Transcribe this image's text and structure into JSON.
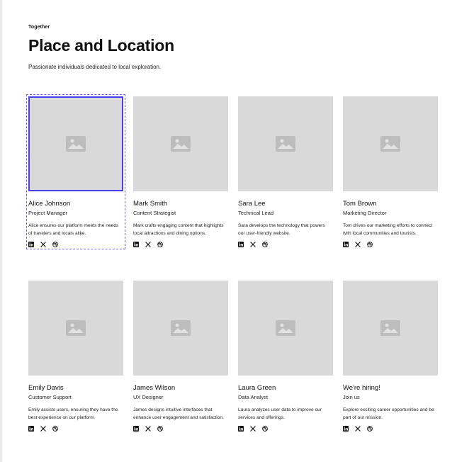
{
  "header": {
    "eyebrow": "Together",
    "title": "Place and Location",
    "subtitle": "Passionate individuals dedicated to local exploration."
  },
  "team": [
    {
      "name": "Alice Johnson",
      "role": "Project Manager",
      "description": "Alice ensures our platform meets the needs of travelers and locals alike."
    },
    {
      "name": "Mark Smith",
      "role": "Content Strategist",
      "description": "Mark crafts engaging content that highlights local attractions and dining options."
    },
    {
      "name": "Sara Lee",
      "role": "Technical Lead",
      "description": "Sara develops the technology that powers our user-friendly website."
    },
    {
      "name": "Tom Brown",
      "role": "Marketing Director",
      "description": "Tom drives our marketing efforts to connect with local communities and tourists."
    },
    {
      "name": "Emily Davis",
      "role": "Customer Support",
      "description": "Emily assists users, ensuring they have the best experience on our platform."
    },
    {
      "name": "James Wilson",
      "role": "UX Designer",
      "description": "James designs intuitive interfaces that enhance user engagement and satisfaction."
    },
    {
      "name": "Laura Green",
      "role": "Data Analyst",
      "description": "Laura analyzes user data to improve our services and offerings."
    },
    {
      "name": "We're hiring!",
      "role": "Join us",
      "description": "Explore exciting career opportunities and be part of our mission."
    }
  ],
  "icons": {
    "social": [
      "linkedin-icon",
      "x-icon",
      "dribbble-icon"
    ],
    "placeholder": "image-placeholder-icon"
  },
  "colors": {
    "selection": "#4b3df0",
    "placeholder_bg": "#d9d9d9"
  }
}
